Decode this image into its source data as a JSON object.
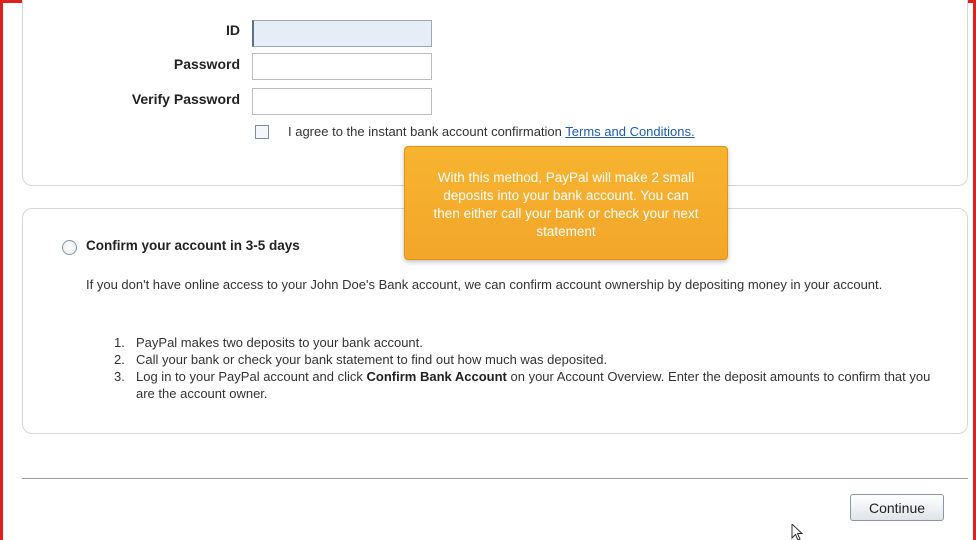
{
  "form": {
    "id_label": "ID",
    "id_value": "",
    "password_label": "Password",
    "password_value": "",
    "verify_password_label": "Verify Password",
    "verify_password_value": "",
    "agree_text": "I agree to the instant bank account confirmation ",
    "terms_link": "Terms and Conditions.",
    "agree_checked": false
  },
  "tooltip": {
    "text": "With this method, PayPal will make 2 small deposits into your bank account. You can then either call your bank or check your next statement"
  },
  "option": {
    "radio_label": "Confirm your account in 3-5 days",
    "selected": false,
    "description": "If you don't have online access to your John Doe's Bank account, we can confirm account ownership by depositing money in your account.",
    "steps": [
      {
        "num": "1.",
        "text": "PayPal makes two deposits to your bank account."
      },
      {
        "num": "2.",
        "text": "Call your bank or check your bank statement to find out how much was deposited."
      },
      {
        "num": "3.",
        "pre": "Log in to your PayPal account and click ",
        "bold": "Confirm Bank Account",
        "post": " on your Account Overview. Enter the deposit amounts to confirm that you are the account owner."
      }
    ]
  },
  "footer": {
    "continue_label": "Continue"
  },
  "colors": {
    "frame": "#e0201f",
    "tooltip": "#f5ad2d",
    "link": "#1f5ca8"
  },
  "icons": {
    "cursor": "mouse-pointer-icon"
  }
}
